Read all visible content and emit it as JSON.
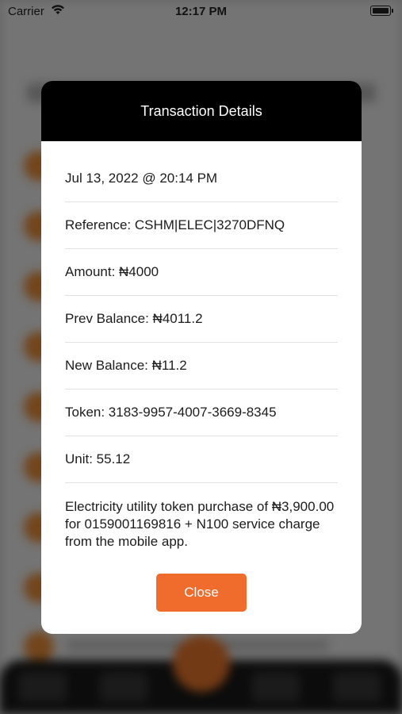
{
  "status_bar": {
    "carrier": "Carrier",
    "time": "12:17 PM"
  },
  "modal": {
    "title": "Transaction Details",
    "date": "Jul 13, 2022 @ 20:14 PM",
    "reference": "Reference: CSHM|ELEC|3270DFNQ",
    "amount": "Amount: ₦4000",
    "prev_balance": "Prev Balance: ₦4011.2",
    "new_balance": "New Balance: ₦11.2",
    "token": "Token: 3183-9957-4007-3669-8345",
    "unit": "Unit: 55.12",
    "description": "Electricity utility token purchase of ₦3,900.00 for 0159001169816 + N100 service charge from the mobile app.",
    "close_label": "Close"
  },
  "colors": {
    "accent": "#ef6c2d",
    "header_bg": "#000000",
    "overlay": "rgba(0,0,0,0.52)"
  }
}
